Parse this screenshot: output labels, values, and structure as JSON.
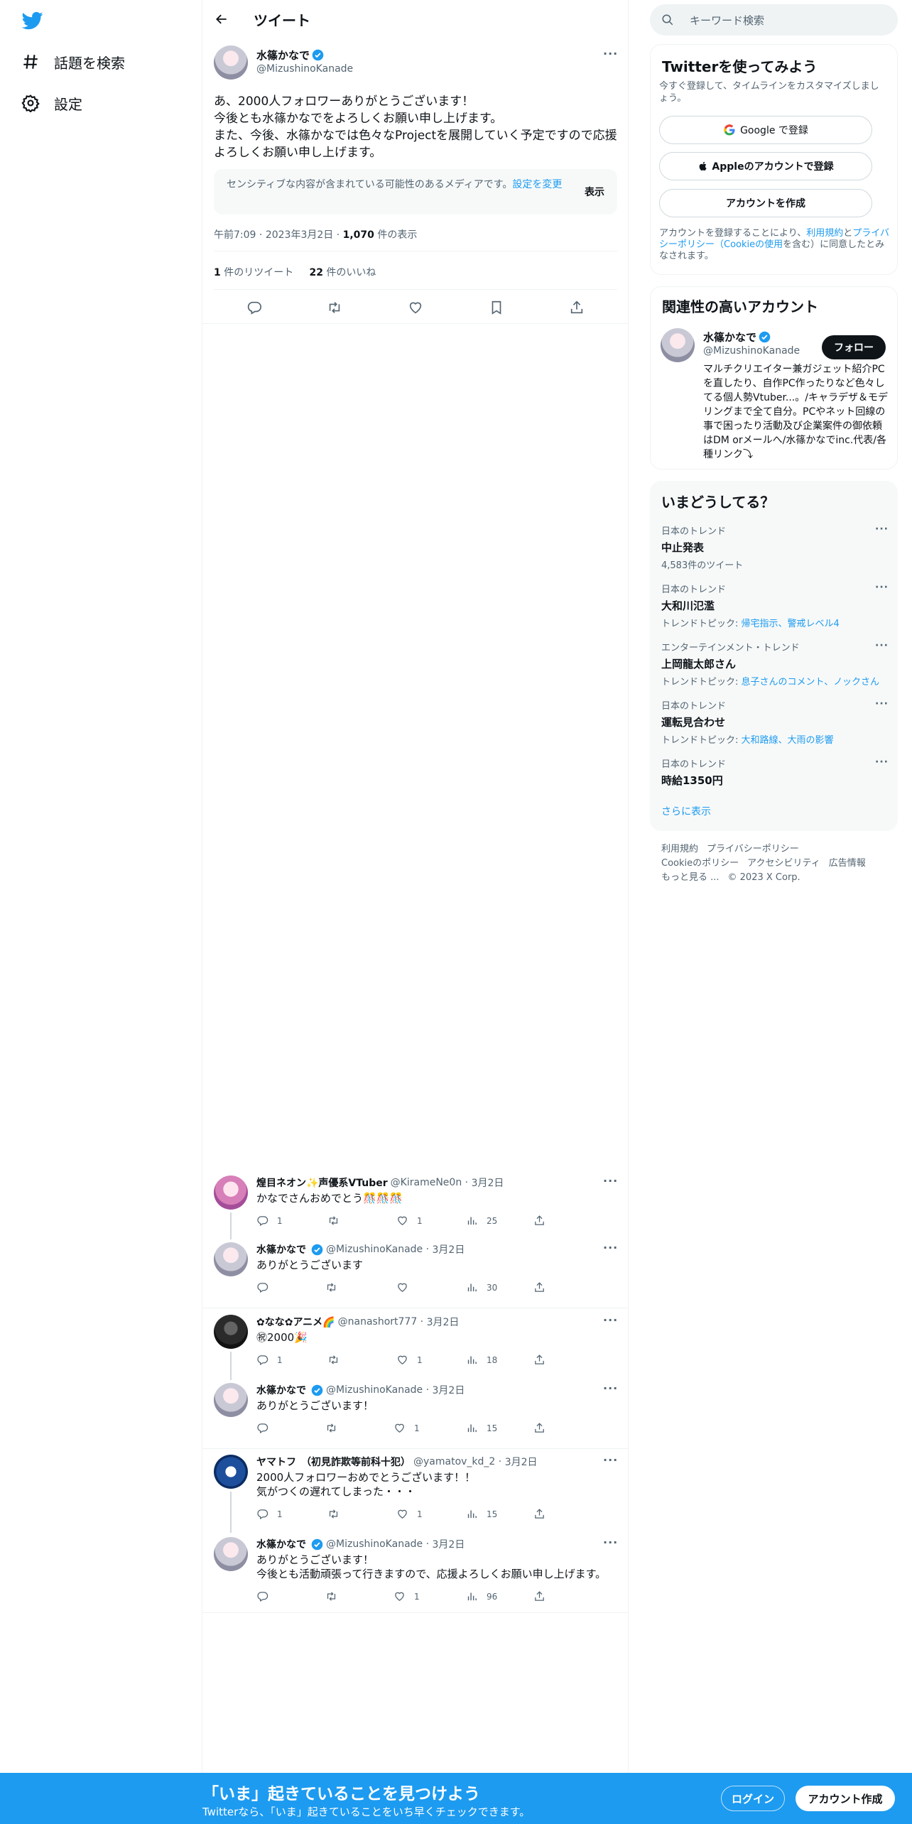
{
  "nav": {
    "explore_label": "話題を検索",
    "settings_label": "設定"
  },
  "header": {
    "title": "ツイート"
  },
  "focal_tweet": {
    "name": "水篠かなで",
    "handle": "@MizushinoKanade",
    "lines": [
      "あ、2000人フォロワーありがとうございます！",
      "今後とも水篠かなでをよろしくお願い申し上げます。",
      "また、今後、水篠かなでは色々なProjectを展開していく予定ですので応援",
      "よろしくお願い申し上げます。"
    ],
    "sensitive_text": "センシティブな内容が含まれている可能性のあるメディアです。",
    "sensitive_link": "設定を変更",
    "sensitive_show": "表示",
    "time": "午前7:09",
    "date": "2023年3月2日",
    "views_count": "1,070",
    "views_label": "件の表示",
    "retweets_count": "1",
    "retweets_label": "件のリツイート",
    "likes_count": "22",
    "likes_label": "件のいいね"
  },
  "replies": [
    {
      "name": "煌目ネオン✨声優系VTuber",
      "handle": "@KirameNe0n",
      "date": "3月2日",
      "lines": [
        "かなでさんおめでとう🎊🎊🎊"
      ],
      "replies": "1",
      "likes": "1",
      "views": "25",
      "verified": false
    },
    {
      "name": "水篠かなで",
      "handle": "@MizushinoKanade",
      "date": "3月2日",
      "lines": [
        "ありがとうございます"
      ],
      "replies": "",
      "likes": "",
      "views": "30",
      "verified": true
    },
    {
      "name": "✿なな✿アニメ🌈",
      "handle": "@nanashort777",
      "date": "3月2日",
      "lines": [
        "㊗2000🎉"
      ],
      "replies": "1",
      "likes": "1",
      "views": "18",
      "verified": false
    },
    {
      "name": "水篠かなで",
      "handle": "@MizushinoKanade",
      "date": "3月2日",
      "lines": [
        "ありがとうございます！"
      ],
      "replies": "",
      "likes": "1",
      "views": "15",
      "verified": true
    },
    {
      "name": "ヤマトフ　（初見詐欺等前科十犯）",
      "handle": "@yamatov_kd_2",
      "date": "3月2日",
      "lines": [
        "2000人フォロワーおめでとうございます！！",
        "気がつくの遅れてしまった・・・"
      ],
      "replies": "1",
      "likes": "1",
      "views": "15",
      "verified": false
    },
    {
      "name": "水篠かなで",
      "handle": "@MizushinoKanade",
      "date": "3月2日",
      "lines": [
        "ありがとうございます！",
        "今後とも活動頑張って行きますので、応援よろしくお願い申し上げます。"
      ],
      "replies": "",
      "likes": "1",
      "views": "96",
      "verified": true
    }
  ],
  "search": {
    "placeholder": "キーワード検索"
  },
  "signup_card": {
    "title": "Twitterを使ってみよう",
    "desc": "今すぐ登録して、タイムラインをカスタマイズしましょう。",
    "google_label": "Google で登録",
    "apple_label": "Appleのアカウントで登録",
    "create_label": "アカウントを作成",
    "terms_prefix": "アカウントを登録することにより、",
    "terms_link": "利用規約",
    "terms_and": "と",
    "privacy_link": "プライバシーポリシー",
    "cookie_link": "（Cookieの使用",
    "terms_suffix": "を含む）に同意したとみなされます。"
  },
  "related": {
    "title": "関連性の高いアカウント",
    "name": "水篠かなで",
    "handle": "@MizushinoKanade",
    "follow_label": "フォロー",
    "bio": "マルチクリエイター兼ガジェット紹介PCを直したり、自作PC作ったりなど色々してる個人勢Vtuber...。/キャラデザ＆モデリングまで全て自分。PCやネット回線の事で困ったり活動及び企業案件の御依頼はDM orメールへ/水篠かなでinc.代表/各種リンク⤵"
  },
  "trends": {
    "title": "いまどうしてる？",
    "items": [
      {
        "context": "日本のトレンド",
        "name": "中止発表",
        "sub_label": "4,583件のツイート",
        "sub_links": ""
      },
      {
        "context": "日本のトレンド",
        "name": "大和川氾濫",
        "sub_label": "トレンドトピック: ",
        "sub_links": "帰宅指示、警戒レベル4"
      },
      {
        "context": "エンターテインメント・トレンド",
        "name": "上岡龍太郎さん",
        "sub_label": "トレンドトピック: ",
        "sub_links": "息子さんのコメント、ノックさん"
      },
      {
        "context": "日本のトレンド",
        "name": "運転見合わせ",
        "sub_label": "トレンドトピック: ",
        "sub_links": "大和路線、大雨の影響"
      },
      {
        "context": "日本のトレンド",
        "name": "時給1350円",
        "sub_label": "",
        "sub_links": ""
      }
    ],
    "show_more": "さらに表示"
  },
  "footer": {
    "terms": "利用規約",
    "privacy": "プライバシーポリシー",
    "cookie": "Cookieのポリシー",
    "accessibility": "アクセシビリティ",
    "ads": "広告情報",
    "more": "もっと見る ...",
    "copyright": "© 2023 X Corp."
  },
  "banner": {
    "title": "「いま」起きていることを見つけよう",
    "subtitle": "Twitterなら、「いま」起きていることをいち早くチェックできます。",
    "login_label": "ログイン",
    "signup_label": "アカウント作成"
  },
  "colors": {
    "accent": "#1d9bf0",
    "text": "#0f1419",
    "muted": "#536471",
    "border": "#eff3f4"
  }
}
